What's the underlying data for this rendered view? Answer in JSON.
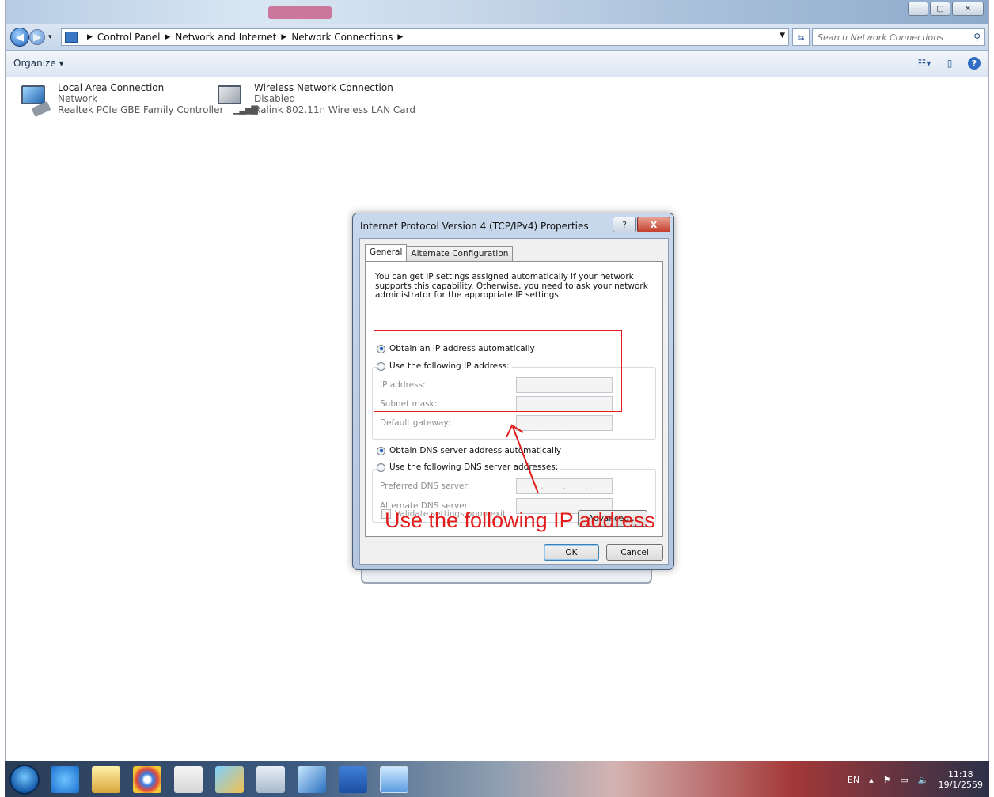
{
  "window": {
    "minimize_label": "—",
    "maximize_label": "▢",
    "close_label": "✕"
  },
  "address": {
    "crumbs": [
      "Control Panel",
      "Network and Internet",
      "Network Connections"
    ],
    "search_placeholder": "Search Network Connections"
  },
  "toolbar": {
    "organize_label": "Organize ▾"
  },
  "connections": [
    {
      "name": "Local Area Connection",
      "status": "Network",
      "adapter": "Realtek PCIe GBE Family Controller"
    },
    {
      "name": "Wireless Network Connection",
      "status": "Disabled",
      "adapter": "Ralink 802.11n Wireless LAN Card"
    }
  ],
  "dialog": {
    "title": "Internet Protocol Version 4 (TCP/IPv4) Properties",
    "help_label": "?",
    "close_label": "X",
    "tabs": [
      "General",
      "Alternate Configuration"
    ],
    "intro": "You can get IP settings assigned automatically if your network supports this capability. Otherwise, you need to ask your network administrator for the appropriate IP settings.",
    "radio_obtain_ip": "Obtain an IP address automatically",
    "radio_use_ip": "Use the following IP address:",
    "ip_fields": [
      "IP address:",
      "Subnet mask:",
      "Default gateway:"
    ],
    "radio_obtain_dns": "Obtain DNS server address automatically",
    "radio_use_dns": "Use the following DNS server addresses:",
    "dns_fields": [
      "Preferred DNS server:",
      "Alternate DNS server:"
    ],
    "validate_label": "Validate settings upon exit",
    "advanced_label": "Advanced...",
    "ok_label": "OK",
    "cancel_label": "Cancel"
  },
  "annotation": {
    "text": "Use the following IP address",
    "color": "#e21b1b"
  },
  "tray": {
    "language": "EN",
    "time": "11:18",
    "date": "19/1/2559"
  }
}
